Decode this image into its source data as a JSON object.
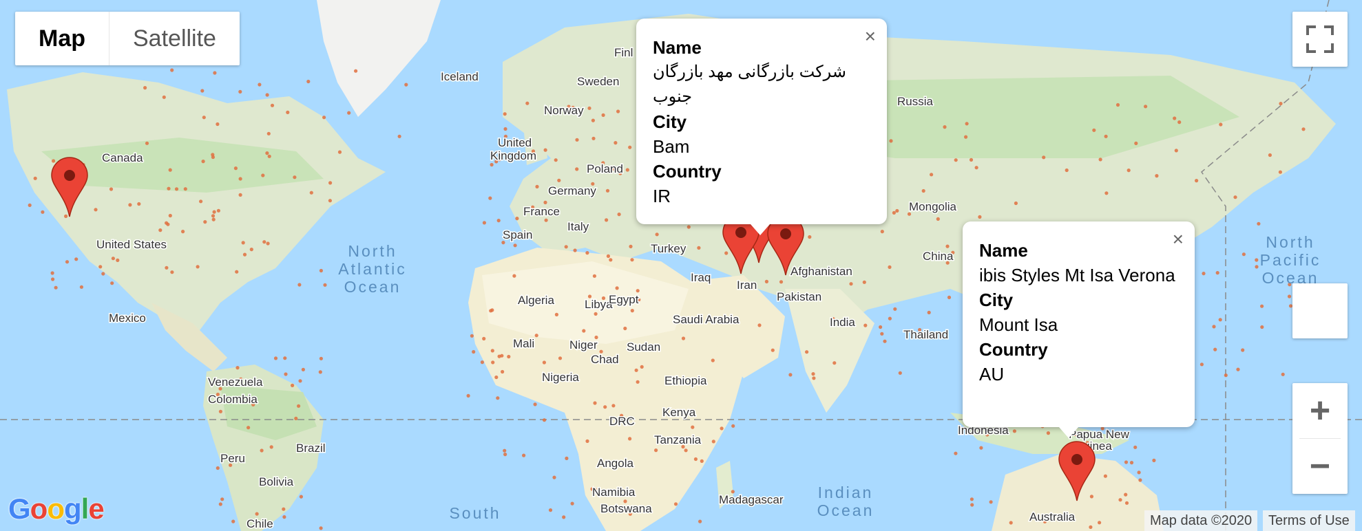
{
  "map_type": {
    "map_label": "Map",
    "satellite_label": "Satellite",
    "selected": "Map"
  },
  "country_labels": [
    {
      "name": "Iceland"
    },
    {
      "name": "Sweden"
    },
    {
      "name": "Finl"
    },
    {
      "name": "Norway"
    },
    {
      "name": "United"
    },
    {
      "name": "Kingdom"
    },
    {
      "name": "Poland"
    },
    {
      "name": "Germany"
    },
    {
      "name": "France"
    },
    {
      "name": "Italy"
    },
    {
      "name": "Spain"
    },
    {
      "name": "Turkey"
    },
    {
      "name": "Iraq"
    },
    {
      "name": "Iran"
    },
    {
      "name": "Afghanistan"
    },
    {
      "name": "Pakistan"
    },
    {
      "name": "India"
    },
    {
      "name": "China"
    },
    {
      "name": "Mongolia"
    },
    {
      "name": "Russia"
    },
    {
      "name": "Thailand"
    },
    {
      "name": "Canada"
    },
    {
      "name": "United States"
    },
    {
      "name": "Mexico"
    },
    {
      "name": "Venezuela"
    },
    {
      "name": "Colombia"
    },
    {
      "name": "Peru"
    },
    {
      "name": "Brazil"
    },
    {
      "name": "Bolivia"
    },
    {
      "name": "Chile"
    },
    {
      "name": "Algeria"
    },
    {
      "name": "Libya"
    },
    {
      "name": "Egypt"
    },
    {
      "name": "Saudi Arabia"
    },
    {
      "name": "Mali"
    },
    {
      "name": "Niger"
    },
    {
      "name": "Chad"
    },
    {
      "name": "Sudan"
    },
    {
      "name": "Nigeria"
    },
    {
      "name": "Ethiopia"
    },
    {
      "name": "Kenya"
    },
    {
      "name": "DRC"
    },
    {
      "name": "Tanzania"
    },
    {
      "name": "Angola"
    },
    {
      "name": "Namibia"
    },
    {
      "name": "Botswana"
    },
    {
      "name": "Madagascar"
    },
    {
      "name": "Indonesia"
    },
    {
      "name": "Papua New"
    },
    {
      "name": "Guinea"
    },
    {
      "name": "Australia"
    }
  ],
  "ocean_labels": [
    {
      "lines": [
        "North",
        "Atlantic",
        "Ocean"
      ]
    },
    {
      "lines": [
        "North",
        "Pacific",
        "Ocean"
      ]
    },
    {
      "lines": [
        "Indian",
        "Ocean"
      ]
    },
    {
      "lines": [
        "South"
      ]
    }
  ],
  "info_windows": [
    {
      "name_label": "Name",
      "name": "شرکت بازرگانی مهد بازرگان جنوب",
      "city_label": "City",
      "city": "Bam",
      "country_label": "Country",
      "country": "IR"
    },
    {
      "name_label": "Name",
      "name": "ibis Styles Mt Isa Verona",
      "city_label": "City",
      "city": "Mount Isa",
      "country_label": "Country",
      "country": "AU"
    }
  ],
  "markers": [
    {
      "place": "Canada/US west"
    },
    {
      "place": "Iran 1"
    },
    {
      "place": "Iran 2"
    },
    {
      "place": "Iran 3"
    },
    {
      "place": "Afghanistan"
    },
    {
      "place": "Mount Isa"
    }
  ],
  "close_symbol": "×",
  "attribution": {
    "map_data": "Map data ©2020",
    "terms": "Terms of Use"
  },
  "logo": {
    "text": "Google"
  },
  "colors": {
    "water": "#aadaff",
    "land": "#e8ecdc",
    "desert": "#f4f0dc",
    "forest": "#c5e3b5",
    "marker": "#ea4335",
    "marker_dark": "#a52714"
  },
  "icons": {
    "fullscreen": "fullscreen-icon",
    "zoom_in": "plus-icon",
    "zoom_out": "minus-icon",
    "close": "close-icon",
    "marker": "map-pin-icon"
  },
  "zoom": {
    "in_symbol": "+",
    "out_symbol": "−"
  }
}
